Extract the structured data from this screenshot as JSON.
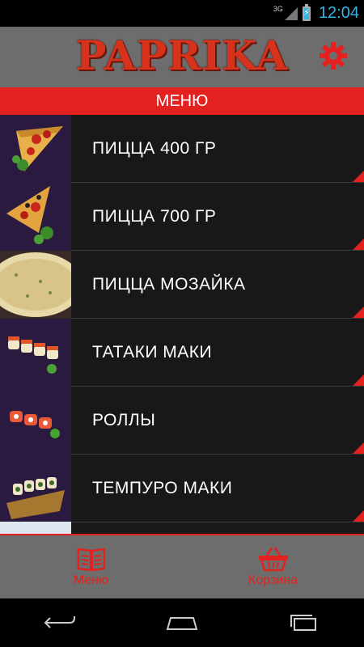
{
  "status_bar": {
    "network": "3G",
    "time": "12:04"
  },
  "header": {
    "logo_text": "PAPRIKA",
    "settings_icon": "gear-icon",
    "accent": "#e3211f"
  },
  "menu_title": "МЕНЮ",
  "menu": {
    "items": [
      {
        "label": "ПИЦЦА 400 ГР",
        "icon": "pizza-slice-image"
      },
      {
        "label": "ПИЦЦА 700 ГР",
        "icon": "pizza-slice-image"
      },
      {
        "label": "ПИЦЦА МОЗАЙКА",
        "icon": "pizza-image"
      },
      {
        "label": "ТАТАКИ МАКИ",
        "icon": "sushi-image"
      },
      {
        "label": "РОЛЛЫ",
        "icon": "rolls-image"
      },
      {
        "label": "ТЕМПУРО МАКИ",
        "icon": "sushi-boat-image"
      }
    ]
  },
  "tabbar": {
    "menu_label": "Меню",
    "cart_label": "Корзина"
  },
  "navbar": {
    "icons": [
      "back-icon",
      "home-icon",
      "recents-icon"
    ]
  }
}
